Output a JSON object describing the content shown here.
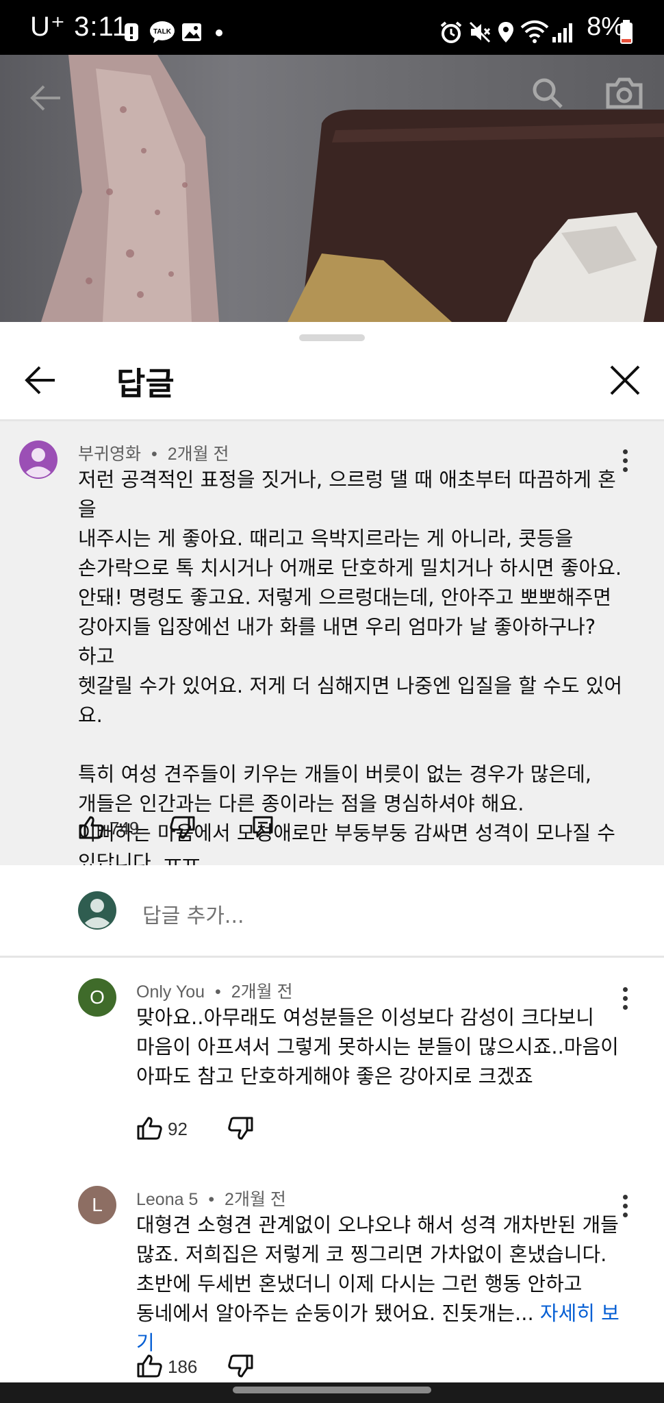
{
  "status_bar": {
    "time": "U⁺ 3:11",
    "battery": "8%",
    "left_icons": [
      "alert-icon",
      "kakaotalk-icon",
      "gallery-icon",
      "dot-icon"
    ],
    "right_icons": [
      "alarm-icon",
      "mute-icon",
      "location-icon",
      "wifi-icon",
      "signal-icon",
      "battery-icon"
    ],
    "talk_badge": "TALK"
  },
  "player": {
    "back_icon": "arrow-left-icon",
    "search_icon": "search-icon",
    "camera_icon": "camera-icon"
  },
  "header": {
    "title": "답글"
  },
  "parent_comment": {
    "author": "부귀영화",
    "time": "2개월 전",
    "avatar_color": "#9b4fb5",
    "body": "저런 공격적인 표정을 짓거나, 으르렁 댈 때 애초부터 따끔하게 혼을\n내주시는 게 좋아요. 때리고 윽박지르라는 게 아니라, 콧등을\n손가락으로 톡 치시거나 어깨로 단호하게 밀치거나 하시면 좋아요.\n안돼! 명령도 좋고요. 저렇게 으르렁대는데, 안아주고 뽀뽀해주면\n강아지들 입장에선 내가 화를 내면 우리 엄마가 날 좋아하구나?  하고\n헷갈릴 수가 있어요. 저게 더 심해지면 나중엔 입질을 할 수도 있어요.\n\n특히 여성 견주들이 키우는 개들이 버릇이 없는 경우가 많은데,\n개들은 인간과는 다른 종이라는 점을 명심하셔야 해요.\n이뻐하는 마음에서 모성애로만 부둥부둥 감싸면 성격이 모나질 수\n있답니다. ㅠㅠ",
    "likes": "749"
  },
  "add_reply": {
    "placeholder": "답글 추가..."
  },
  "replies": [
    {
      "author": "Only You",
      "time": "2개월 전",
      "avatar_letter": "O",
      "avatar_color": "#3f6b2a",
      "body": "맞아요..아무래도 여성분들은 이성보다 감성이 크다보니\n마음이 아프셔서 그렇게 못하시는 분들이 많으시죠..마음이\n아파도 참고 단호하게해야 좋은 강아지로 크겠죠",
      "likes": "92"
    },
    {
      "author": "Leona 5",
      "time": "2개월 전",
      "avatar_letter": "L",
      "avatar_color": "#8d6e63",
      "body": "대형견 소형견 관계없이 오냐오냐 해서 성격 개차반된 개들\n많죠. 저희집은 저렇게 코 찡그리면 가차없이 혼냈습니다.\n초반에 두세번 혼냈더니 이제 다시는 그런 행동 안하고\n동네에서 알아주는 순둥이가 됐어요. 진돗개는...",
      "more": "자세히 보기",
      "likes": "186"
    }
  ]
}
